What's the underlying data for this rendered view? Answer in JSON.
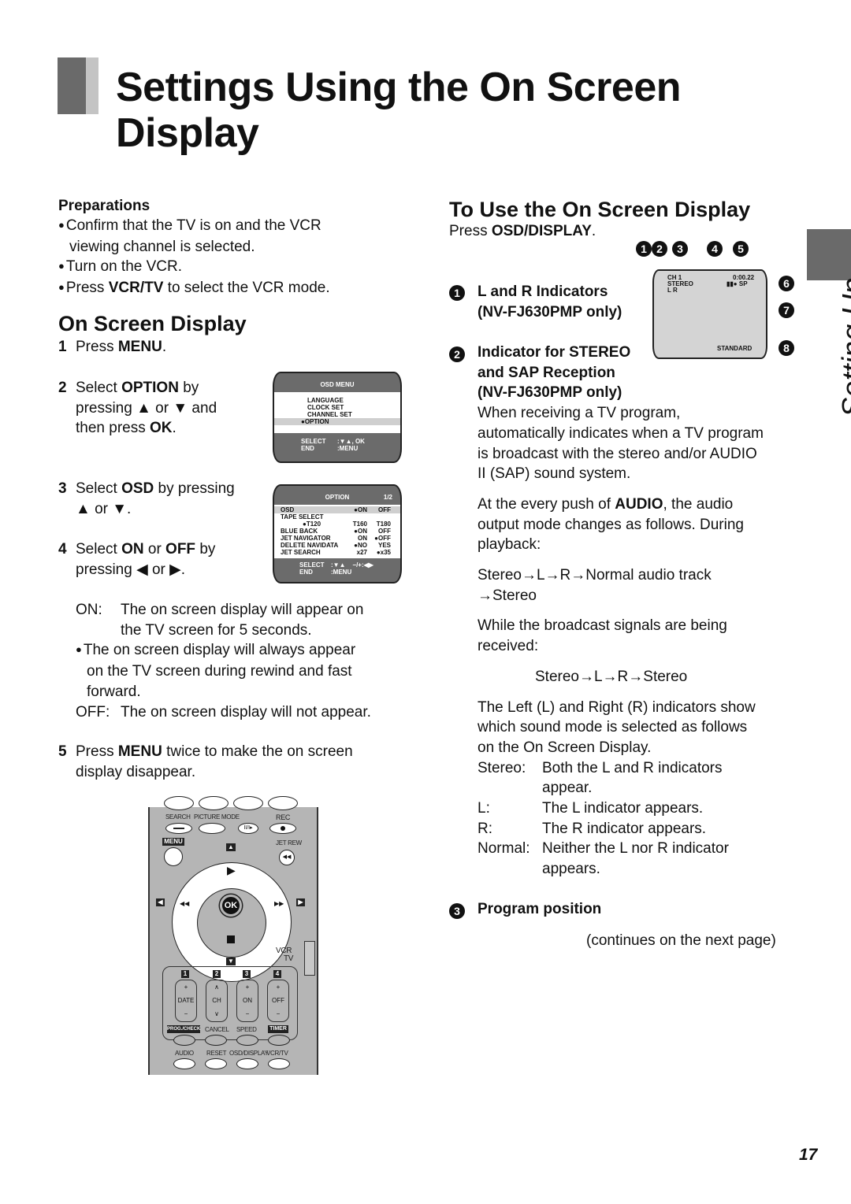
{
  "title": {
    "line1": "Settings Using the On Screen",
    "line2": "Display"
  },
  "side_tab": {
    "label": "Setting Up"
  },
  "preparations": {
    "heading": "Preparations",
    "items": [
      {
        "pre": "Confirm that the TV is on and the VCR",
        "line2": "viewing channel is selected."
      },
      {
        "pre": "Turn on the VCR."
      },
      {
        "pre": "Press ",
        "bold": "VCR/TV",
        "post": " to select the VCR mode."
      }
    ]
  },
  "osd_section": {
    "heading": "On Screen Display",
    "steps": [
      {
        "num": "1",
        "pre": "Press ",
        "bold": "MENU",
        "post": "."
      },
      {
        "num": "2",
        "pre": "Select ",
        "bold": "OPTION",
        "post": " by",
        "line2": "pressing ▲ or ▼ and",
        "line3_pre": "then press ",
        "line3_bold": "OK",
        "line3_post": "."
      },
      {
        "num": "3",
        "pre": "Select ",
        "bold": "OSD",
        "post": " by pressing",
        "line2": "▲ or ▼."
      },
      {
        "num": "4",
        "pre": "Select ",
        "bold": "ON",
        "mid": " or ",
        "bold2": "OFF",
        "post": " by",
        "line2": "pressing ◀ or ▶."
      },
      {
        "num": "5",
        "pre": "Press ",
        "bold": "MENU",
        "post": " twice to make the on screen",
        "line2": "display disappear."
      }
    ],
    "on_label": "ON:",
    "on_text1": "The on screen display will appear on",
    "on_text2": "the TV screen for 5 seconds.",
    "note1": "The on screen display will always appear",
    "note2": "on the TV screen during rewind and fast",
    "note3": "forward.",
    "off_label": "OFF:",
    "off_text": "The on screen display will not appear."
  },
  "osd_menu_screen": {
    "title": "OSD MENU",
    "items": [
      "LANGUAGE",
      "CLOCK SET",
      "CHANNEL SET",
      "●OPTION"
    ],
    "footer": [
      {
        "k": "SELECT",
        "v": ":▼▲, OK"
      },
      {
        "k": "END",
        "v": ":MENU"
      }
    ]
  },
  "option_screen": {
    "title": "OPTION",
    "page": "1/2",
    "rows": [
      {
        "name": "OSD",
        "a": "●ON",
        "b": "OFF"
      },
      {
        "name": "TAPE SELECT",
        "a": "",
        "b": ""
      },
      {
        "name": "",
        "x": "●T120",
        "a": "T160",
        "b": "T180"
      },
      {
        "name": "BLUE BACK",
        "a": "●ON",
        "b": "OFF"
      },
      {
        "name": "JET NAVIGATOR",
        "a": "ON",
        "b": "●OFF"
      },
      {
        "name": "DELETE NAVIDATA",
        "a": "●NO",
        "b": "YES"
      },
      {
        "name": "JET SEARCH",
        "a": "x27",
        "b": "●x35"
      }
    ],
    "footer": [
      {
        "k": "SELECT",
        "v": ":▼▲    −/+:◀▶"
      },
      {
        "k": "END",
        "v": ":MENU"
      }
    ]
  },
  "use_section": {
    "heading": "To Use the On Screen Display",
    "press_pre": "Press ",
    "press_bold": "OSD/DISPLAY",
    "press_post": ".",
    "callouts": [
      "1",
      "2",
      "3",
      "4",
      "5",
      "6",
      "7",
      "8"
    ],
    "screen": {
      "ch": "CH 1",
      "stereo": "STEREO",
      "lr": "L R",
      "time": "0:00.22",
      "status": "▮▮● SP",
      "mode": "STANDARD"
    },
    "item1_title": "L and R Indicators",
    "item1_sub": "(NV-FJ630PMP only)",
    "item2_title1": "Indicator for STEREO",
    "item2_title2": "and SAP Reception",
    "item2_sub": "(NV-FJ630PMP only)",
    "item2_body": [
      "When receiving a TV program,",
      "automatically indicates when a TV program",
      "is broadcast with the stereo and/or AUDIO",
      "II (SAP) sound system."
    ],
    "audio_pre": "At the every push of ",
    "audio_bold": "AUDIO",
    "audio_post": ", the audio",
    "audio_lines": [
      "output mode changes as follows. During",
      "playback:"
    ],
    "seq1_line1": "Stereo→L→R→Normal audio track",
    "seq1_line2": "→Stereo",
    "broadcast_lines": [
      "While the broadcast signals are being",
      "received:"
    ],
    "seq2": "Stereo→L→R→Stereo",
    "lr_lines": [
      "The Left (L) and Right (R) indicators show",
      "which sound mode is selected as follows",
      "on the On Screen Display."
    ],
    "modes": [
      {
        "k": "Stereo:",
        "v": "Both the L and R indicators",
        "v2": "appear."
      },
      {
        "k": "L:",
        "v": "The L indicator appears."
      },
      {
        "k": "R:",
        "v": "The R indicator appears."
      },
      {
        "k": "Normal:",
        "v": "Neither the L nor R indicator",
        "v2": "appears."
      }
    ],
    "item3_title": "Program position",
    "continues": "(continues on the next page)"
  },
  "remote": {
    "search": "SEARCH",
    "picture_mode": "PICTURE MODE",
    "rec": "REC",
    "menu": "MENU",
    "jet_rew": "JET REW",
    "ok": "OK",
    "vcr": "VCR",
    "tv": "TV",
    "pause": "II/I▸",
    "nums": [
      "1",
      "2",
      "3",
      "4"
    ],
    "rockers": [
      "DATE",
      "CH",
      "ON",
      "OFF"
    ],
    "row1": [
      "PROG./CHECK",
      "CANCEL",
      "SPEED",
      "TIMER"
    ],
    "row2": [
      "AUDIO",
      "RESET",
      "OSD/DISPLAY",
      "VCR/TV"
    ]
  },
  "page_number": "17"
}
